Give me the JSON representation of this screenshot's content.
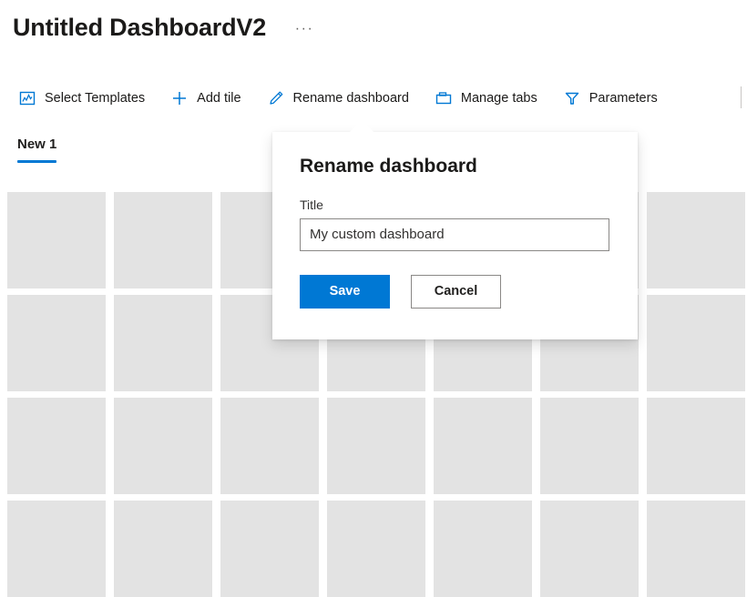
{
  "header": {
    "title": "Untitled DashboardV2",
    "more_label": "···",
    "more_icon": "ellipsis-icon"
  },
  "command_bar": {
    "items": [
      {
        "label": "Select Templates",
        "icon": "chart-template-icon"
      },
      {
        "label": "Add tile",
        "icon": "plus-icon"
      },
      {
        "label": "Rename dashboard",
        "icon": "pencil-icon"
      },
      {
        "label": "Manage tabs",
        "icon": "tab-folder-icon"
      },
      {
        "label": "Parameters",
        "icon": "filter-funnel-icon"
      }
    ]
  },
  "tabs": {
    "items": [
      {
        "label": "New 1",
        "selected": true
      }
    ]
  },
  "grid": {
    "columns": 7,
    "rows": 4,
    "tile_count": 28
  },
  "dialog": {
    "heading": "Rename dashboard",
    "field_label": "Title",
    "field_value": "My custom dashboard",
    "field_placeholder": "My custom dashboard",
    "save_label": "Save",
    "cancel_label": "Cancel"
  },
  "colors": {
    "accent": "#0078d4",
    "tile": "#e3e3e3",
    "text": "#1b1a19",
    "border": "#8a8886"
  }
}
